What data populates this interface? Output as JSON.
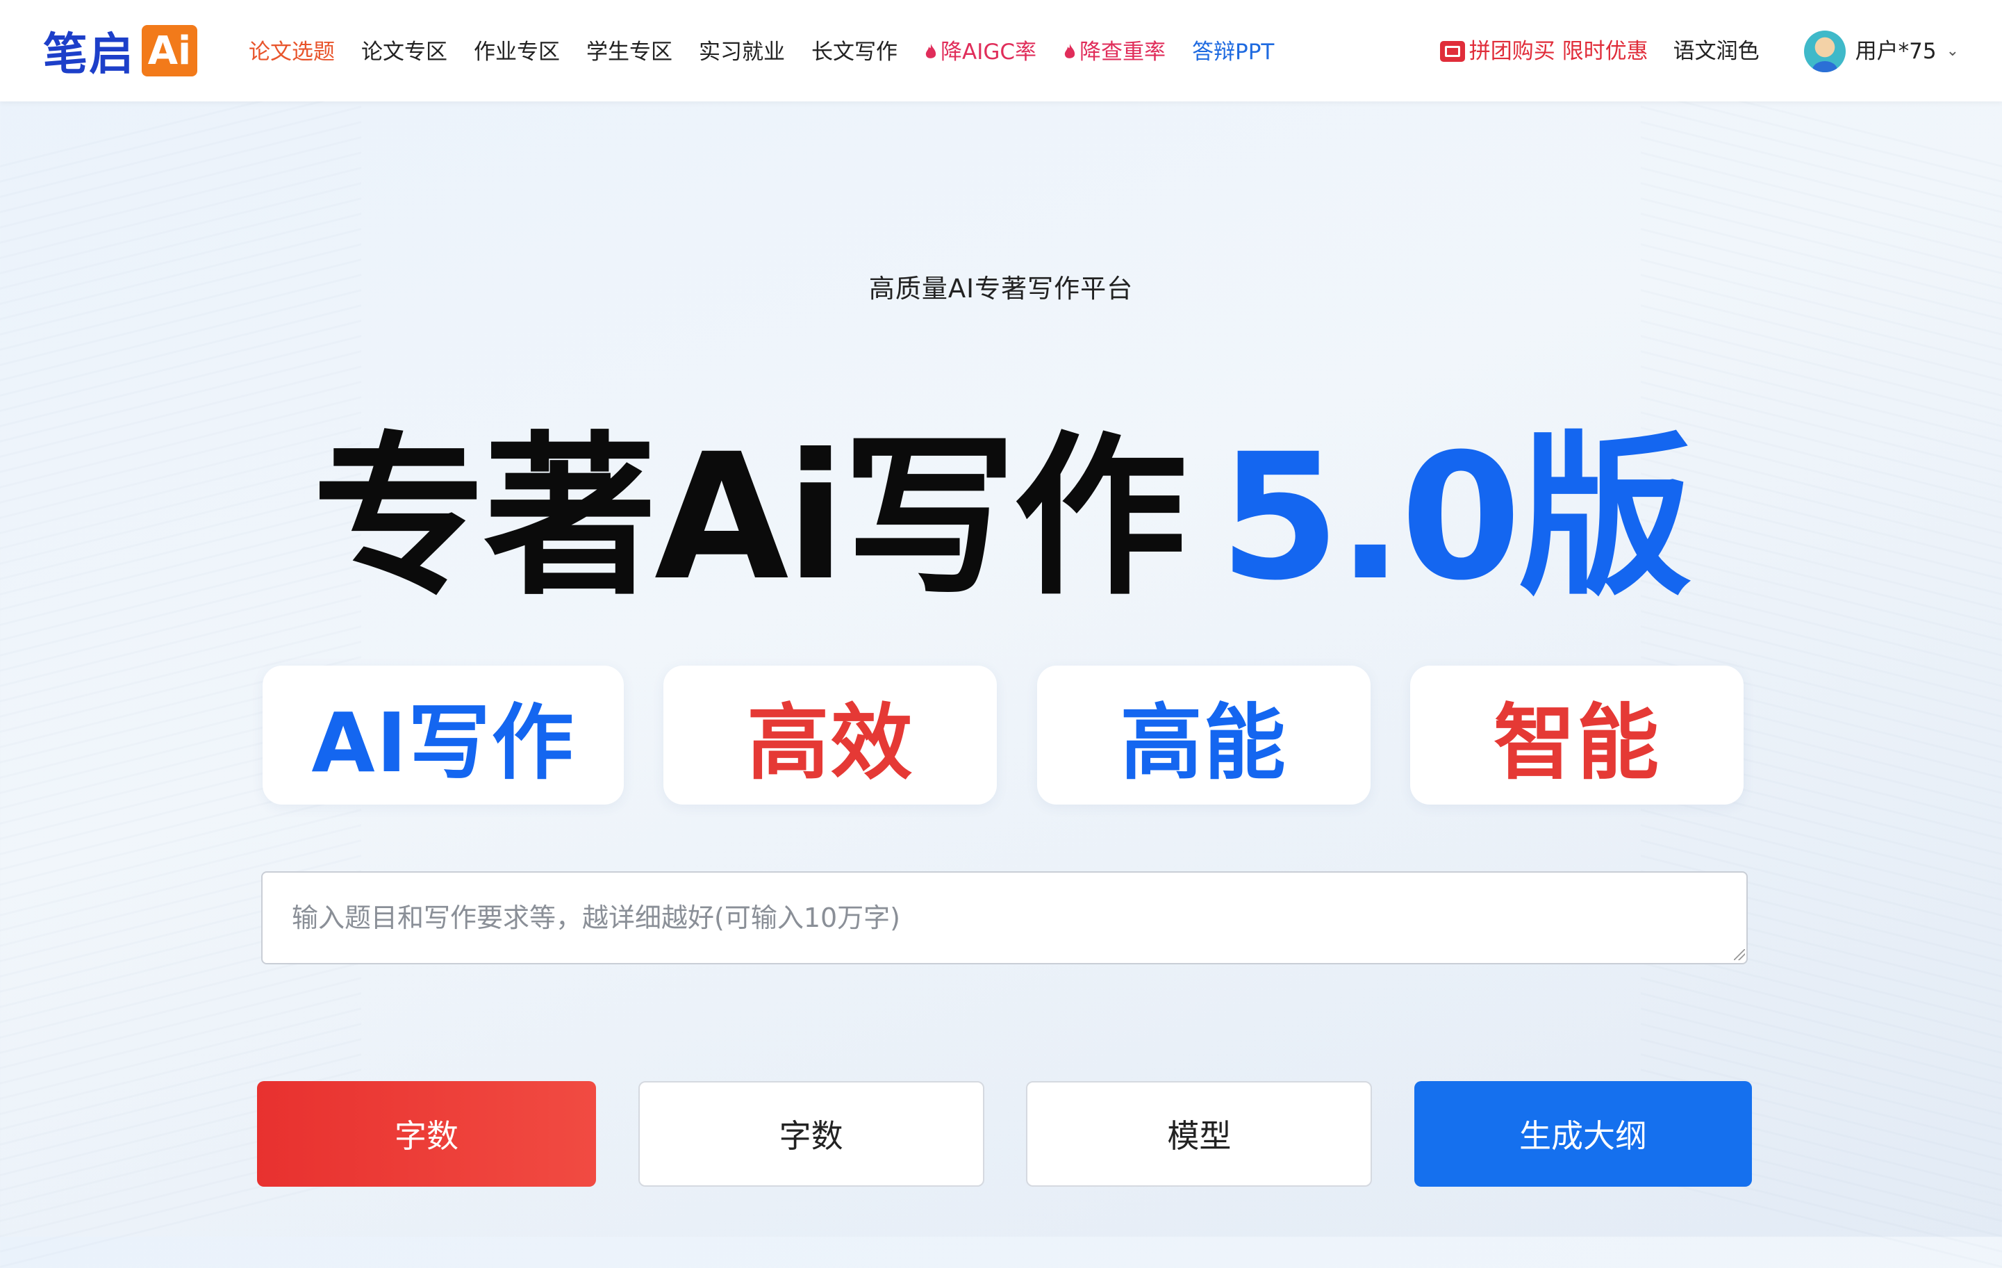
{
  "brand": {
    "name": "笔启",
    "badge": "Ai"
  },
  "nav": {
    "items": [
      {
        "label": "论文选题",
        "style": "active"
      },
      {
        "label": "论文专区",
        "style": "normal"
      },
      {
        "label": "作业专区",
        "style": "normal"
      },
      {
        "label": "学生专区",
        "style": "normal"
      },
      {
        "label": "实习就业",
        "style": "normal"
      },
      {
        "label": "长文写作",
        "style": "normal"
      },
      {
        "label": "降AIGC率",
        "style": "hot",
        "icon": "flame-icon"
      },
      {
        "label": "降查重率",
        "style": "hot",
        "icon": "flame-icon"
      },
      {
        "label": "答辩PPT",
        "style": "blue"
      }
    ]
  },
  "header_right": {
    "promo_label": "拼团购买 限时优惠",
    "polish_label": "语文润色",
    "user_name": "用户*75"
  },
  "hero": {
    "subtitle": "高质量AI专著写作平台",
    "title_main": "专著Ai写作",
    "title_version": "5.0版"
  },
  "features": [
    {
      "label": "AI写作",
      "color": "#1466f0"
    },
    {
      "label": "高效",
      "color": "#e53935"
    },
    {
      "label": "高能",
      "color": "#1466f0"
    },
    {
      "label": "智能",
      "color": "#e53935"
    }
  ],
  "prompt": {
    "placeholder": "输入题目和写作要求等，越详细越好(可输入10万字)",
    "value": ""
  },
  "actions": {
    "word_count_selected": "字数",
    "word_count": "字数",
    "model": "模型",
    "generate": "生成大纲"
  },
  "colors": {
    "brand_blue": "#1d3fc9",
    "brand_orange": "#f27a1a",
    "accent_blue": "#1466f0",
    "accent_red": "#e53935",
    "nav_active": "#e8542b",
    "nav_hot": "#e02d5a"
  }
}
